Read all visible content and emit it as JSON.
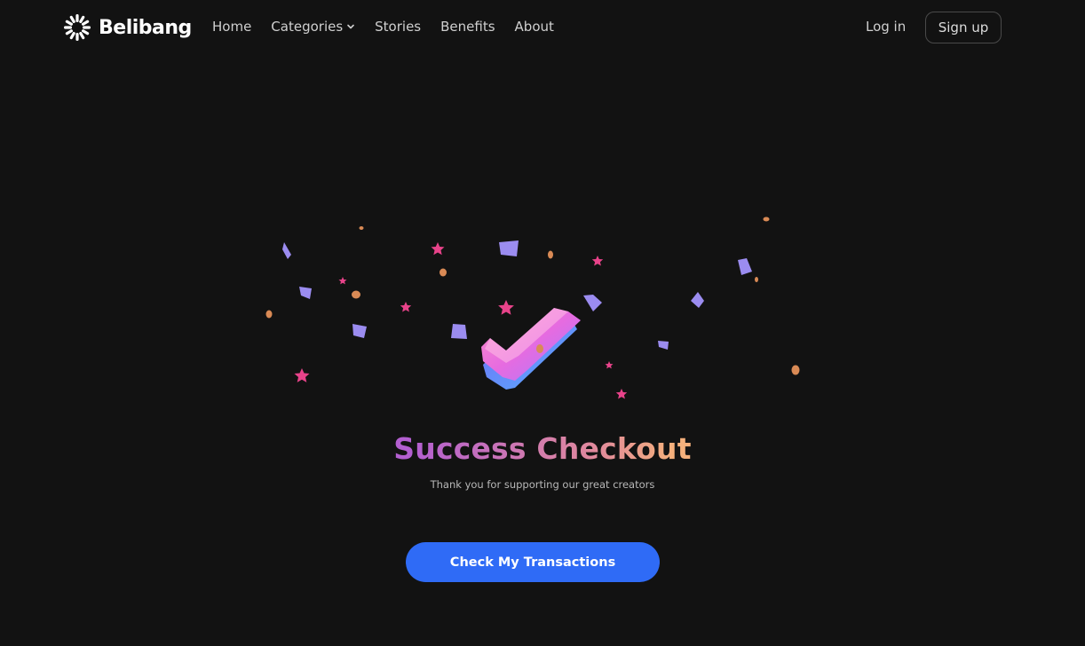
{
  "brand": {
    "name": "Belibang",
    "logo_icon": "sunburst-icon"
  },
  "nav": {
    "items": [
      {
        "label": "Home"
      },
      {
        "label": "Categories",
        "has_dropdown": true
      },
      {
        "label": "Stories"
      },
      {
        "label": "Benefits"
      },
      {
        "label": "About"
      }
    ],
    "login_label": "Log in",
    "signup_label": "Sign up"
  },
  "hero": {
    "illustration": "checkmark-confetti-icon",
    "title": "Success Checkout",
    "subtitle": "Thank you for supporting our great creators",
    "cta_label": "Check My Transactions"
  },
  "colors": {
    "background": "#121212",
    "cta": "#2f6bf6",
    "title_gradient_start": "#b35fd0",
    "title_gradient_end": "#f4b07c",
    "confetti_purple": "#9b8cf0",
    "confetti_pink": "#e8438a",
    "confetti_orange": "#d98a55"
  }
}
